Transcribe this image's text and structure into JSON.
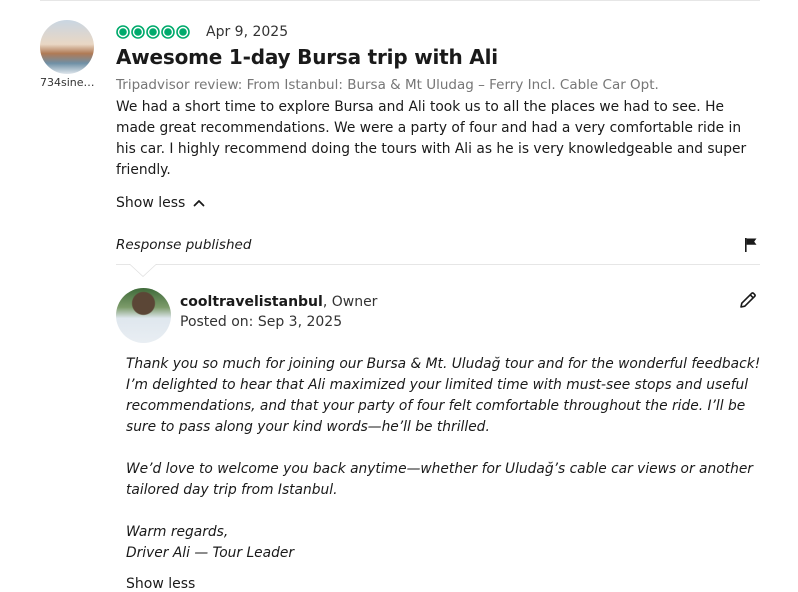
{
  "reviewer": {
    "name": "734sine…"
  },
  "review": {
    "rating": 5,
    "rating_max": 5,
    "rating_color": "#00aa6c",
    "date": "Apr 9, 2025",
    "title": "Awesome 1-day Bursa trip with Ali",
    "subtitle": "Tripadvisor review: From Istanbul: Bursa & Mt Uludag – Ferry Incl. Cable Car Opt.",
    "body": "We had a short time to explore Bursa and Ali took us to all the places we had to see. He made great recommendations. We were a party of four and had a very comfortable ride in his car. I highly recommend doing the tours with Ali as he is very knowledgeable and super friendly.",
    "toggle_label": "Show less",
    "toggle_icon": "chevron-up-icon"
  },
  "response": {
    "label": "Response published",
    "flag_icon": "flag-icon",
    "owner_name": "cooltravelistanbul",
    "owner_role": ", Owner",
    "posted_on": "Posted on:  Sep 3, 2025",
    "edit_icon": "pencil-icon",
    "paragraphs": [
      "Thank you so much for joining our Bursa & Mt. Uludağ tour and for the wonderful feedback! I’m delighted to hear that Ali maximized your limited time with must-see stops and useful recommendations, and that your party of four felt comfortable throughout the ride. I’ll be sure to pass along your kind words—he’ll be thrilled.",
      "We’d love to welcome you back anytime—whether for Uludağ’s cable car views or another tailored day trip from Istanbul.",
      "Warm regards,",
      "Driver Ali — Tour Leader"
    ],
    "toggle_label": "Show less"
  },
  "colors": {
    "brand_green": "#00aa6c",
    "text": "#1a1a1a",
    "muted": "#767676",
    "divider": "#e6e6e6"
  }
}
